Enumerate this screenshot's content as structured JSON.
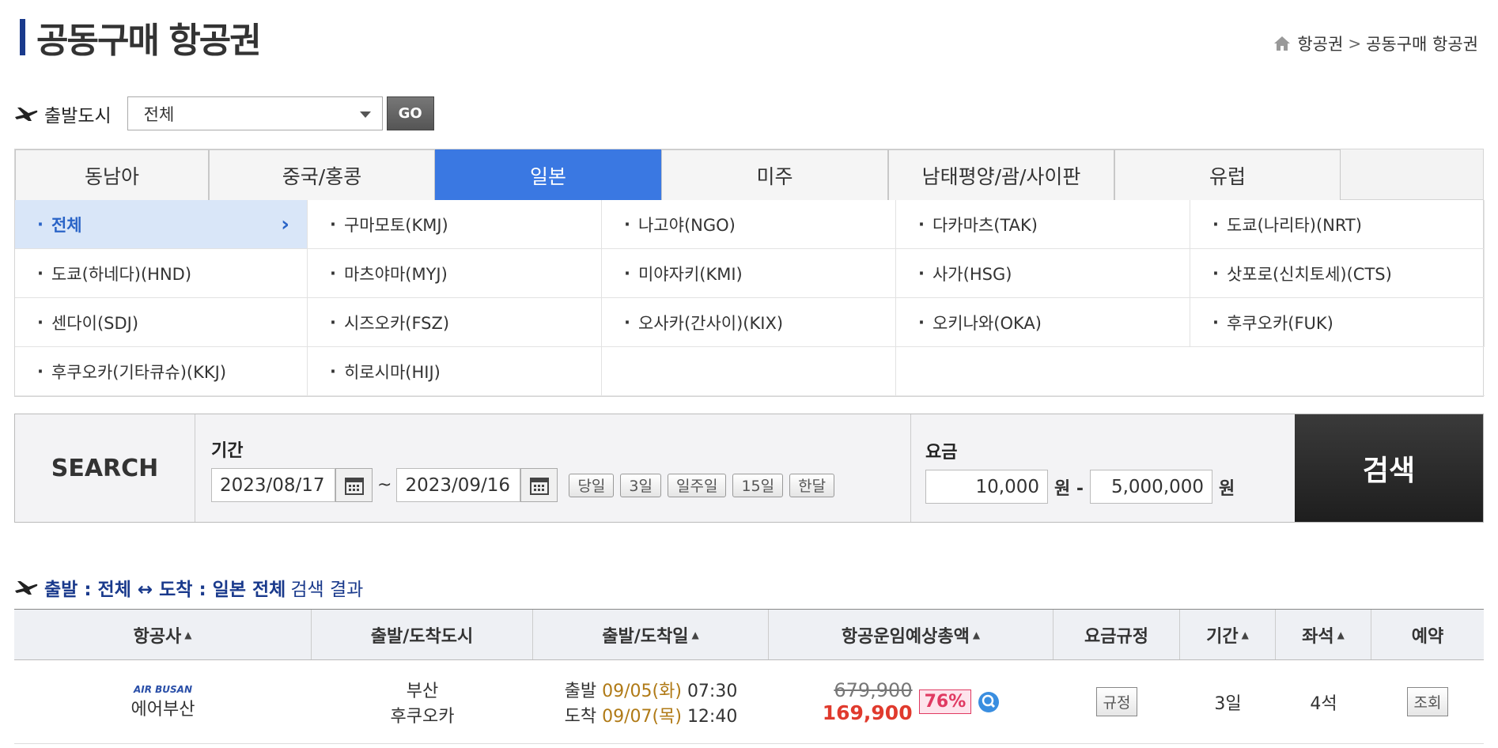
{
  "header": {
    "title": "공동구매 항공권",
    "breadcrumb": [
      "항공권",
      "공동구매 항공권"
    ]
  },
  "departure": {
    "label": "출발도시",
    "selected": "전체",
    "go_label": "GO"
  },
  "regions": {
    "tabs": [
      "동남아",
      "중국/홍콩",
      "일본",
      "미주",
      "남태평양/괌/사이판",
      "유럽"
    ],
    "active_tab": "일본",
    "cities": [
      "전체",
      "구마모토(KMJ)",
      "나고야(NGO)",
      "다카마츠(TAK)",
      "도쿄(나리타)(NRT)",
      "도쿄(하네다)(HND)",
      "마츠야마(MYJ)",
      "미야자키(KMI)",
      "사가(HSG)",
      "삿포로(신치토세)(CTS)",
      "센다이(SDJ)",
      "시즈오카(FSZ)",
      "오사카(간사이)(KIX)",
      "오키나와(OKA)",
      "후쿠오카(FUK)",
      "후쿠오카(기타큐슈)(KKJ)",
      "히로시마(HIJ)"
    ],
    "active_city": "전체"
  },
  "search": {
    "label": "SEARCH",
    "period_label": "기간",
    "date_from": "2023/08/17",
    "date_to": "2023/09/16",
    "tilde": "~",
    "quick_ranges": [
      "당일",
      "3일",
      "일주일",
      "15일",
      "한달"
    ],
    "fare_label": "요금",
    "fare_min": "10,000",
    "fare_max": "5,000,000",
    "won_dash": "원 -",
    "won": "원",
    "search_button": "검색"
  },
  "result": {
    "prefix": "출발 : 전체 ↔ 도착 : 일본 전체",
    "suffix": "검색 결과",
    "columns": [
      "항공사",
      "출발/도착도시",
      "출발/도착일",
      "항공운임예상총액",
      "요금규정",
      "기간",
      "좌석",
      "예약"
    ],
    "rows": [
      {
        "airline_logo": "AIR BUSAN",
        "airline": "에어부산",
        "from": "부산",
        "to": "후쿠오카",
        "dep_label": "출발",
        "dep_date": "09/05(화)",
        "dep_time": "07:30",
        "arr_label": "도착",
        "arr_date": "09/07(목)",
        "arr_time": "12:40",
        "old_price": "679,900",
        "new_price": "169,900",
        "discount": "76%",
        "rule_button": "규정",
        "period": "3일",
        "seats": "4석",
        "reserve_button": "조회"
      }
    ]
  },
  "colors": {
    "accent": "#3a78e2",
    "title_bar": "#1a3a8c",
    "price_red": "#e03a2d",
    "date_gold": "#b07a16"
  }
}
